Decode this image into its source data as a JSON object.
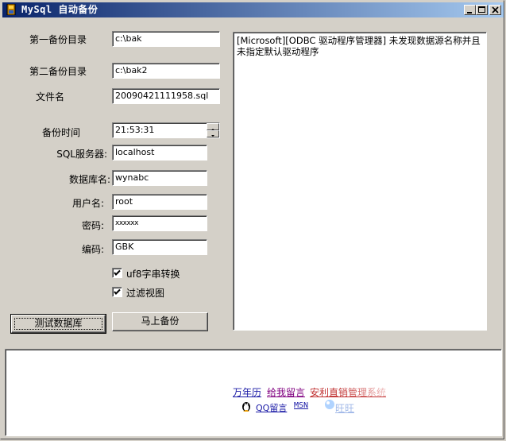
{
  "window": {
    "title": "MySql 自动备份",
    "controls": {
      "minimize": "minimize",
      "maximize": "maximize",
      "close": "close"
    }
  },
  "form": {
    "backup_dir1_label": "第一备份目录",
    "backup_dir1_value": "c:\\bak",
    "backup_dir2_label": "第二备份目录",
    "backup_dir2_value": "c:\\bak2",
    "filename_label": "文件名",
    "filename_value": "20090421111958.sql",
    "backup_time_label": "备份时间",
    "backup_time_value": "21:53:31",
    "sql_server_label": "SQL服务器:",
    "sql_server_value": "localhost",
    "db_name_label": "数据库名:",
    "db_name_value": "wynabc",
    "username_label": "用户名:",
    "username_value": "root",
    "password_label": "密码:",
    "password_value": "xxxxxx",
    "encoding_label": "编码:",
    "encoding_value": "GBK",
    "utf8_checkbox_label": "uf8字串转换",
    "utf8_checked": true,
    "filter_views_label": "过滤视图",
    "filter_views_checked": true
  },
  "buttons": {
    "test_db": "测试数据库",
    "backup_now": "马上备份"
  },
  "log": {
    "text": "[Microsoft][ODBC 驱动程序管理器] 未发现数据源名称并且未指定默认驱动程序"
  },
  "footer_links": {
    "calendar": "万年历",
    "leave_message": "给我留言",
    "anli_system": "安利直销管理系统",
    "qq_message": "QQ留言",
    "msn": "MSN",
    "wangwang": "旺旺"
  },
  "colors": {
    "title_gradient_start": "#0a246a",
    "title_gradient_end": "#a6caf0",
    "link_blue": "#1a1aa6",
    "link_purple": "#800080",
    "link_red": "#c03030",
    "link_faded": "#e8a0a0",
    "window_bg": "#d4d0c8"
  }
}
